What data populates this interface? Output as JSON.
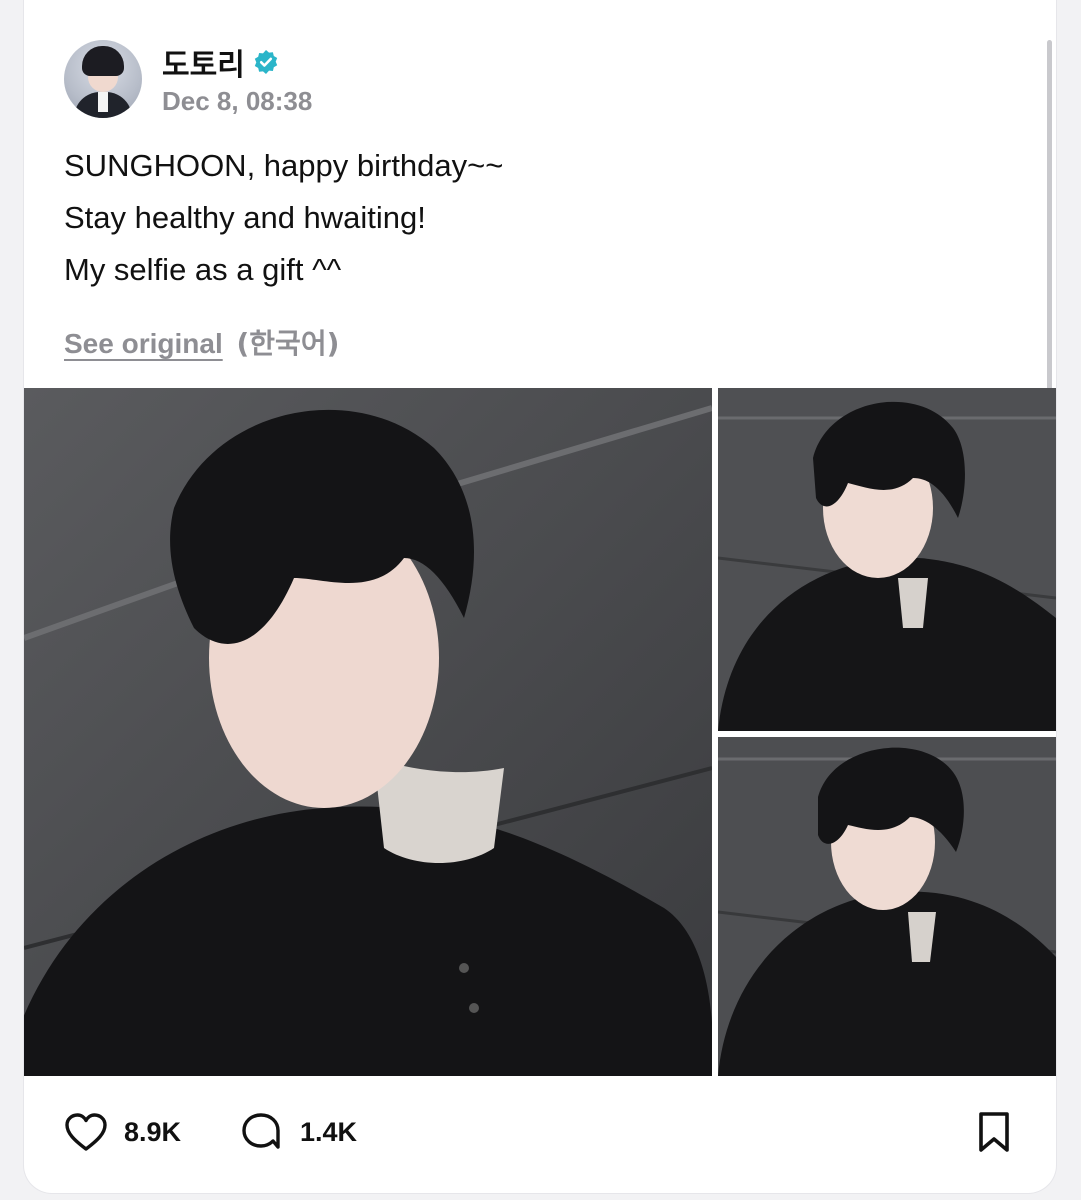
{
  "post": {
    "author_name": "도토리",
    "verified": true,
    "timestamp": "Dec 8, 08:38",
    "lines": [
      "SUNGHOON, happy birthday~~",
      "Stay healthy and hwaiting!",
      "My selfie as a gift ^^"
    ],
    "see_original_label": "See original",
    "original_language": "(한국어)"
  },
  "actions": {
    "likes": "8.9K",
    "comments": "1.4K"
  },
  "icons": {
    "avatar": "profile-avatar",
    "verified": "verified-badge-icon",
    "like": "heart-icon",
    "comment": "comment-bubble-icon",
    "bookmark": "bookmark-icon"
  },
  "colors": {
    "verified_badge": "#2bb5c9",
    "secondary_text": "#8e8e93"
  }
}
